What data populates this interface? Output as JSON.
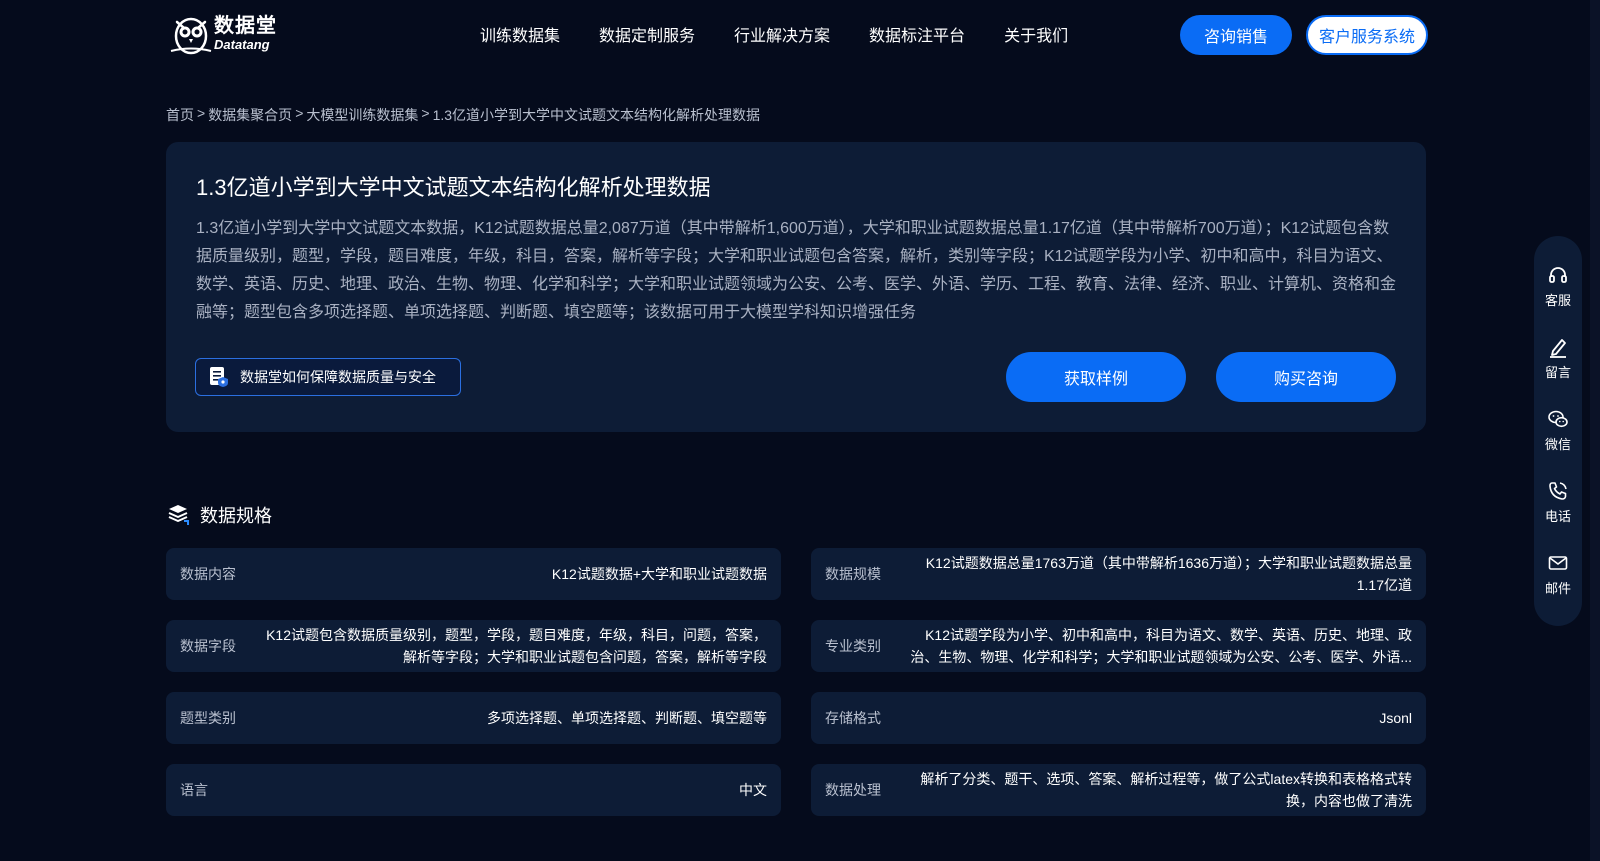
{
  "header": {
    "logo": {
      "cn": "数据堂",
      "en": "Datatang",
      "icon": "owl-logo-icon"
    },
    "nav": [
      {
        "label": "训练数据集"
      },
      {
        "label": "数据定制服务"
      },
      {
        "label": "行业解决方案"
      },
      {
        "label": "数据标注平台"
      },
      {
        "label": "关于我们"
      }
    ],
    "sales_button": "咨询销售",
    "cs_button": "客户服务系统"
  },
  "breadcrumb": [
    {
      "label": "首页"
    },
    {
      "label": "数据集聚合页"
    },
    {
      "label": "大模型训练数据集"
    },
    {
      "label": "1.3亿道小学到大学中文试题文本结构化解析处理数据"
    }
  ],
  "breadcrumb_sep": ">",
  "hero": {
    "title": "1.3亿道小学到大学中文试题文本结构化解析处理数据",
    "description": "1.3亿道小学到大学中文试题文本数据，K12试题数据总量2,087万道（其中带解析1,600万道），大学和职业试题数据总量1.17亿道（其中带解析700万道）；K12试题包含数据质量级别，题型，学段，题目难度，年级，科目，答案，解析等字段；大学和职业试题包含答案，解析，类别等字段；K12试题学段为小学、初中和高中，科目为语文、数学、英语、历史、地理、政治、生物、物理、化学和科学；大学和职业试题领域为公安、公考、医学、外语、学历、工程、教育、法律、经济、职业、计算机、资格和金融等；题型包含多项选择题、单项选择题、判断题、填空题等；该数据可用于大模型学科知识增强任务",
    "quality_link": "数据堂如何保障数据质量与安全",
    "sample_button": "获取样例",
    "buy_button": "购买咨询"
  },
  "spec": {
    "title": "数据规格",
    "items": [
      {
        "label": "数据内容",
        "value": "K12试题数据+大学和职业试题数据"
      },
      {
        "label": "数据规模",
        "value": "K12试题数据总量1763万道（其中带解析1636万道）；大学和职业试题数据总量1.17亿道"
      },
      {
        "label": "数据字段",
        "value": "K12试题包含数据质量级别，题型，学段，题目难度，年级，科目，问题，答案，解析等字段；大学和职业试题包含问题，答案，解析等字段"
      },
      {
        "label": "专业类别",
        "value": "K12试题学段为小学、初中和高中，科目为语文、数学、英语、历史、地理、政治、生物、物理、化学和科学；大学和职业试题领域为公安、公考、医学、外语..."
      },
      {
        "label": "题型类别",
        "value": "多项选择题、单项选择题、判断题、填空题等"
      },
      {
        "label": "存储格式",
        "value": "Jsonl"
      },
      {
        "label": "语言",
        "value": "中文"
      },
      {
        "label": "数据处理",
        "value": "解析了分类、题干、选项、答案、解析过程等，做了公式latex转换和表格格式转换，内容也做了清洗"
      }
    ]
  },
  "float_panel": [
    {
      "label": "客服",
      "icon": "headset-icon"
    },
    {
      "label": "留言",
      "icon": "pen-icon"
    },
    {
      "label": "微信",
      "icon": "wechat-icon"
    },
    {
      "label": "电话",
      "icon": "phone-icon"
    },
    {
      "label": "邮件",
      "icon": "mail-icon"
    }
  ],
  "colors": {
    "background": "#050b1c",
    "card": "#0d1c36",
    "accent": "#0a6cf5",
    "muted_text": "#a9b1c2"
  }
}
